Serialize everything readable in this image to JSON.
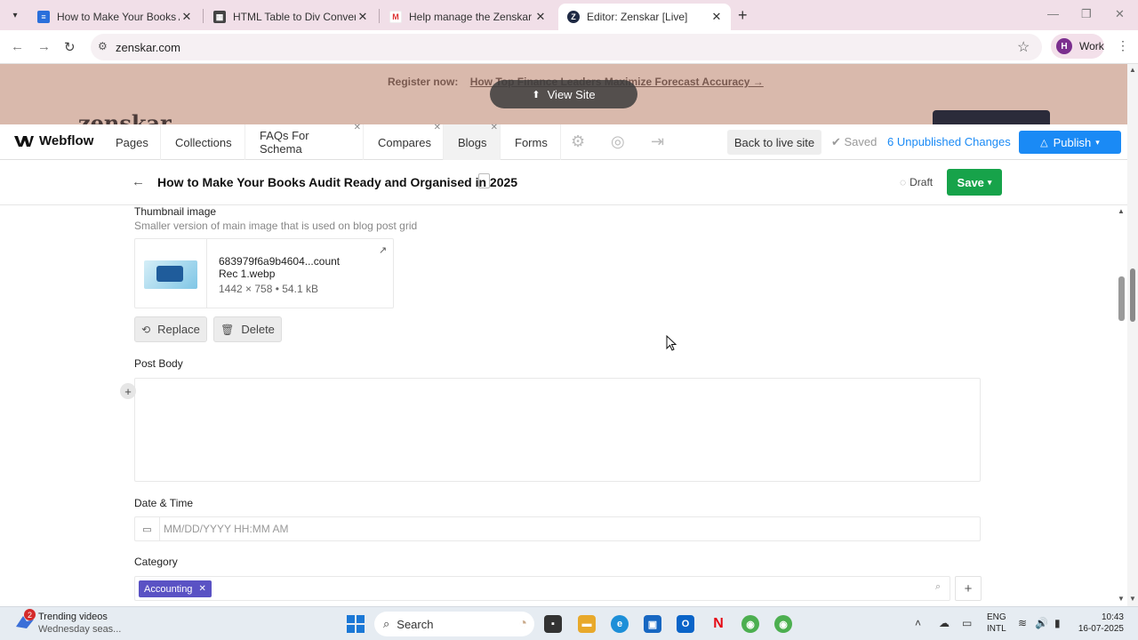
{
  "browser": {
    "tabs": [
      {
        "title": "How to Make Your Books Audit",
        "active": false
      },
      {
        "title": "HTML Table to Div Converter",
        "active": false
      },
      {
        "title": "Help manage the Zenskar [Live]",
        "active": false
      },
      {
        "title": "Editor: Zenskar [Live]",
        "active": true
      }
    ],
    "url": "zenskar.com",
    "profile_initial": "H",
    "profile_label": "Work"
  },
  "site_preview": {
    "register_label": "Register now:",
    "register_link": "How Top Finance Leaders Maximize Forecast Accuracy →",
    "view_site": "View Site",
    "logo_text": "zenskar"
  },
  "editor_bar": {
    "brand": "Webflow",
    "tabs": [
      "Pages",
      "Collections",
      "FAQs For Schema",
      "Compares",
      "Blogs",
      "Forms"
    ],
    "active_tab": "Blogs",
    "back_to_live": "Back to live site",
    "saved": "✔ Saved",
    "unpublished": "6 Unpublished Changes",
    "publish": "Publish"
  },
  "item": {
    "title": "How to Make Your Books Audit Ready and Organised in 2025",
    "status": "Draft",
    "save": "Save"
  },
  "fields": {
    "thumbnail_label": "Thumbnail image",
    "thumbnail_help": "Smaller version of main image that is used on blog post grid",
    "file_name_line1": "683979f6a9b4604...count",
    "file_name_line2": "Rec 1.webp",
    "file_meta": "1442 × 758 • 54.1 kB",
    "replace": "Replace",
    "delete": "Delete",
    "post_body_label": "Post Body",
    "date_label": "Date & Time",
    "date_placeholder": "MM/DD/YYYY HH:MM AM",
    "category_label": "Category",
    "category_chip": "Accounting"
  },
  "taskbar": {
    "weather_badge": "2",
    "weather_title": "Trending videos",
    "weather_sub": "Wednesday seas...",
    "search": "Search",
    "lang_1": "ENG",
    "lang_2": "INTL",
    "time": "10:43",
    "date": "16-07-2025"
  },
  "colors": {
    "accent_blue": "#1a8af5",
    "save_green": "#17a34a",
    "chip_purple": "#5a52c4",
    "banner_bg": "#d9b9ac"
  }
}
